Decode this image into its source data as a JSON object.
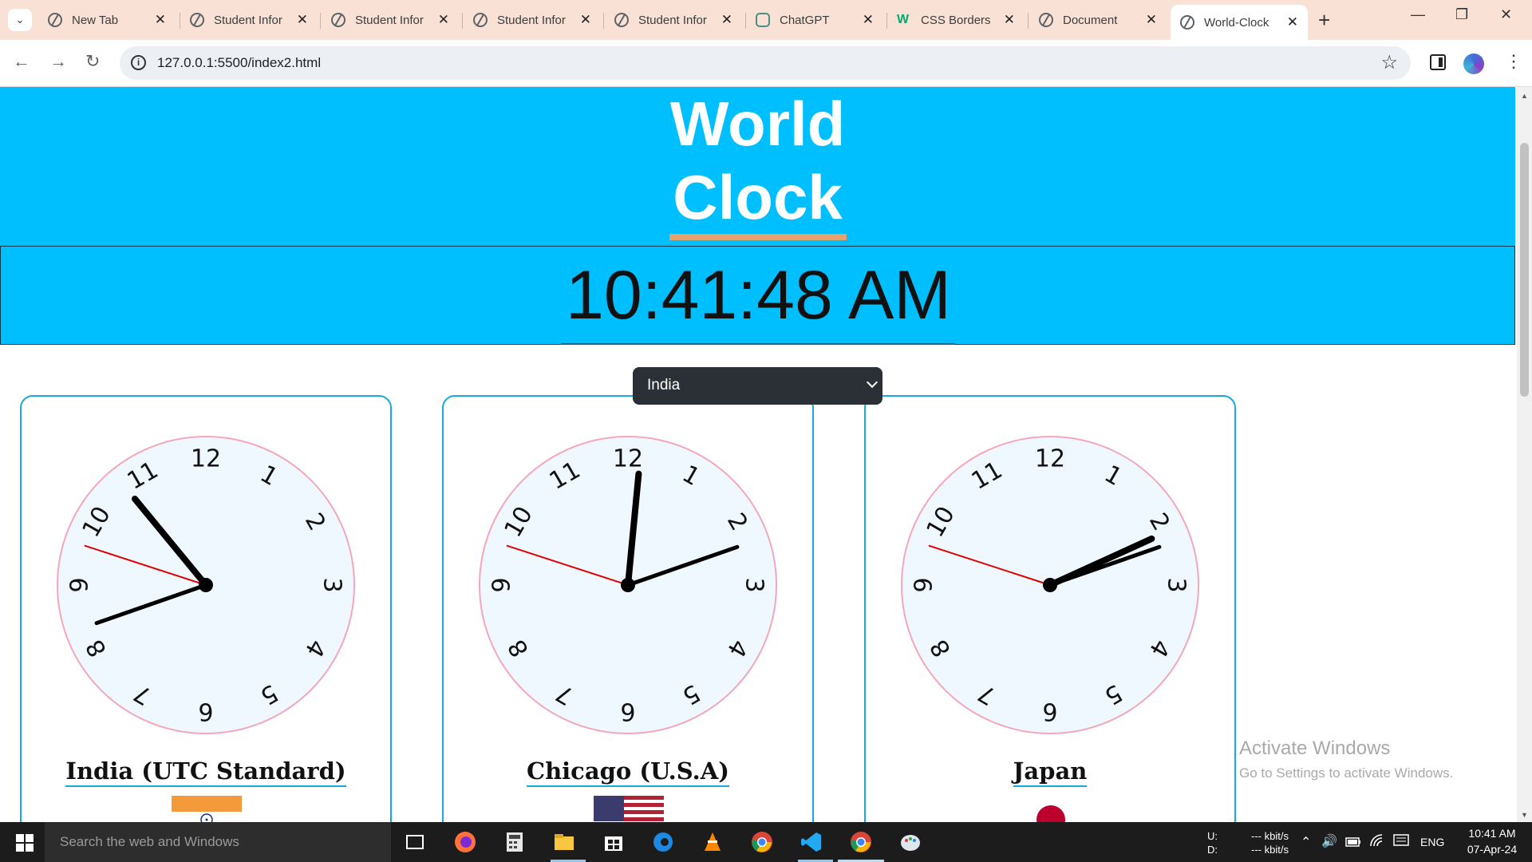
{
  "browser": {
    "tabs": [
      {
        "title": "New Tab",
        "icon": "chrome-icon"
      },
      {
        "title": "Student Infor",
        "icon": "globe-icon"
      },
      {
        "title": "Student Infor",
        "icon": "globe-icon"
      },
      {
        "title": "Student Infor",
        "icon": "globe-icon"
      },
      {
        "title": "Student Infor",
        "icon": "globe-icon"
      },
      {
        "title": "ChatGPT",
        "icon": "chatgpt-icon"
      },
      {
        "title": "CSS Borders",
        "icon": "w3schools-icon"
      },
      {
        "title": "Document",
        "icon": "globe-icon"
      },
      {
        "title": "World-Clock",
        "icon": "globe-icon",
        "active": true
      }
    ],
    "w3_glyph": "W",
    "url": "127.0.0.1:5500/index2.html"
  },
  "page": {
    "title_line1": "World",
    "title_line2": "Clock",
    "current_time": "10:41:48 AM",
    "select": {
      "selected": "India"
    },
    "clocks": [
      {
        "city": "India (UTC Standard)",
        "hour": 10,
        "minute": 41,
        "second": 48,
        "flag": "india"
      },
      {
        "city": "Chicago (U.S.A)",
        "hour": 0,
        "minute": 11,
        "second": 48,
        "flag": "usa"
      },
      {
        "city": "Japan",
        "hour": 2,
        "minute": 11,
        "second": 48,
        "flag": "japan"
      }
    ],
    "dial_numbers": [
      "12",
      "1",
      "2",
      "3",
      "4",
      "5",
      "6",
      "7",
      "8",
      "9",
      "10",
      "11"
    ]
  },
  "watermark": {
    "line1": "Activate Windows",
    "line2": "Go to Settings to activate Windows."
  },
  "taskbar": {
    "search_placeholder": "Search the web and Windows",
    "net_up_label": "U:",
    "net_down_label": "D:",
    "net_up": "--- kbit/s",
    "net_down": "--- kbit/s",
    "language": "ENG",
    "time": "10:41 AM",
    "date": "07-Apr-24"
  },
  "colors": {
    "header": "#00bfff",
    "card_border": "#1aa8e0",
    "dial_face": "#f0f8ff",
    "dial_rim": "#f4a7b9",
    "second_hand": "#e10000",
    "title_underline": "#e2a36c"
  }
}
